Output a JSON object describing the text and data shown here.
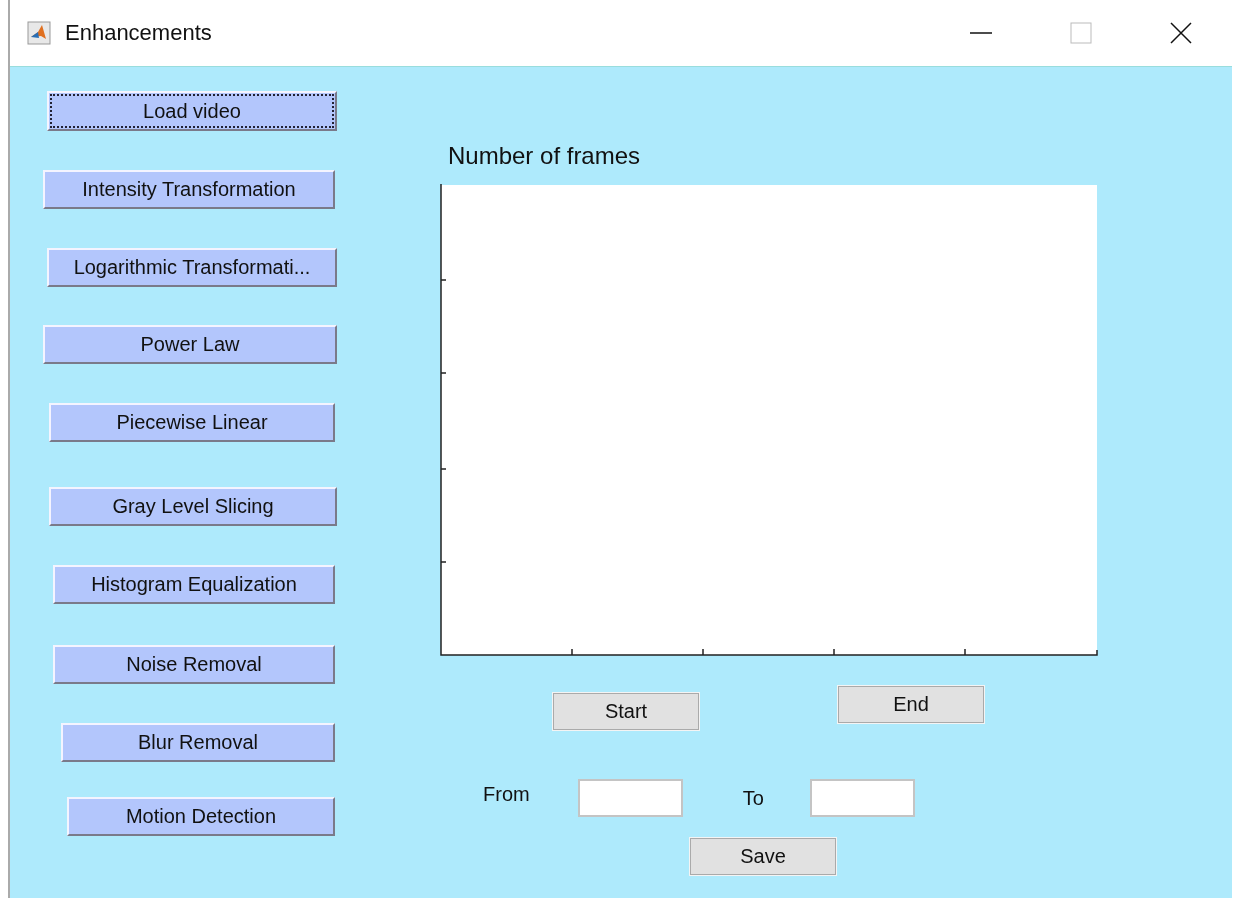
{
  "window": {
    "title": "Enhancements"
  },
  "buttons": [
    {
      "label": "Load video",
      "focused": true
    },
    {
      "label": "Intensity Transformation",
      "focused": false
    },
    {
      "label": "Logarithmic Transformati...",
      "focused": false
    },
    {
      "label": "Power Law",
      "focused": false
    },
    {
      "label": "Piecewise Linear",
      "focused": false
    },
    {
      "label": "Gray Level Slicing",
      "focused": false
    },
    {
      "label": "Histogram Equalization",
      "focused": false
    },
    {
      "label": "Noise Removal",
      "focused": false
    },
    {
      "label": "Blur Removal",
      "focused": false
    },
    {
      "label": "Motion Detection",
      "focused": false
    }
  ],
  "plot": {
    "title": "Number of frames"
  },
  "range_buttons": [
    "Start",
    "End"
  ],
  "from": {
    "label": "From"
  },
  "to": {
    "label": "To"
  },
  "save_button": "Save"
}
